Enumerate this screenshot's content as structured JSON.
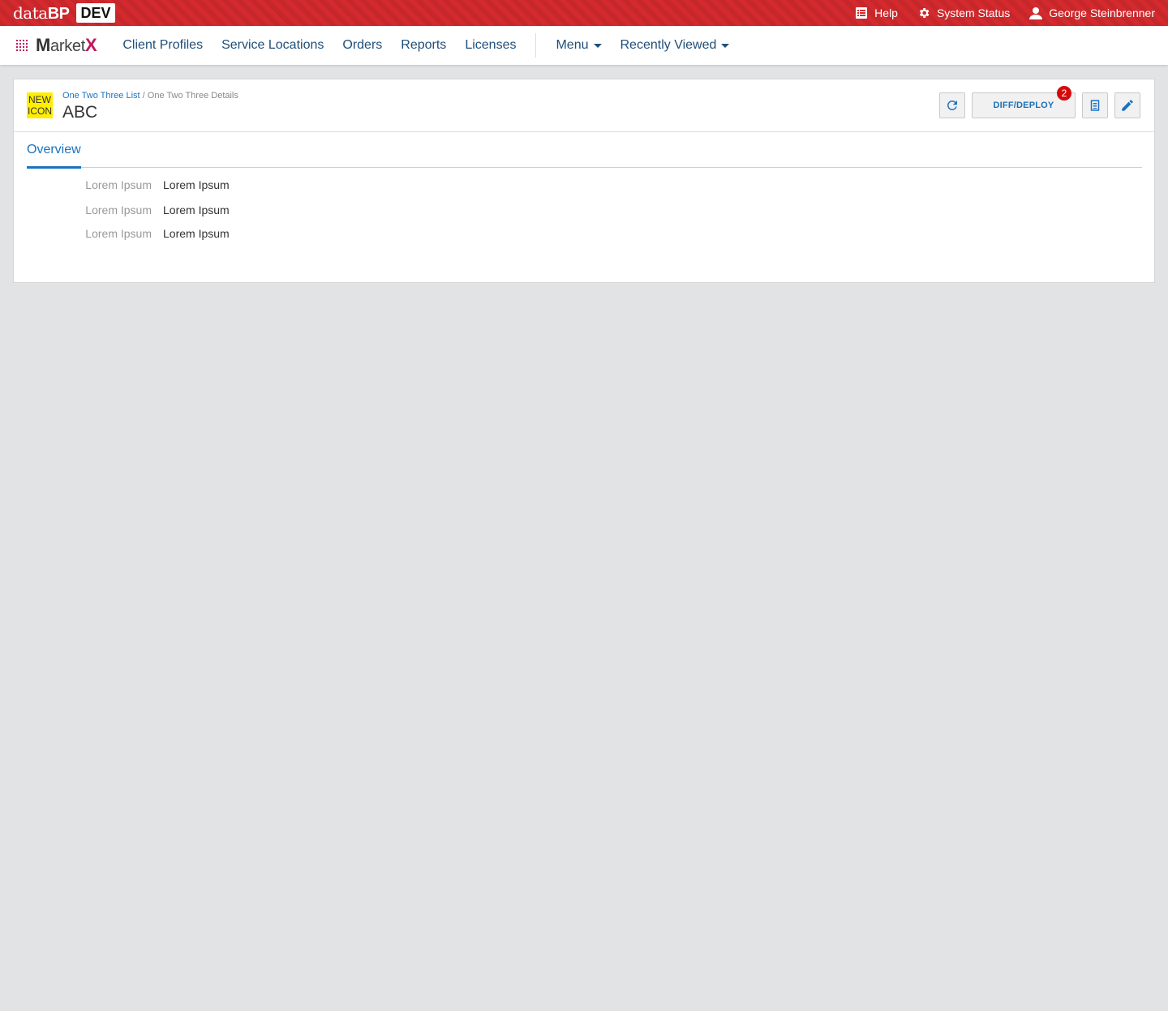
{
  "topbar": {
    "brand_light": "data",
    "brand_bold": "BP",
    "env": "DEV",
    "help": "Help",
    "system_status": "System Status",
    "user": "George Steinbrenner",
    "color": "#d42a2e"
  },
  "navbar": {
    "logo_m": "M",
    "logo_mid": "arket",
    "logo_x": "X",
    "items": [
      "Client Profiles",
      "Service Locations",
      "Orders",
      "Reports",
      "Licenses"
    ],
    "menu": "Menu",
    "recently_viewed": "Recently Viewed"
  },
  "header": {
    "new_icon_line1": "NEW",
    "new_icon_line2": "ICON",
    "breadcrumb_link": "One Two Three List",
    "breadcrumb_sep": "/",
    "breadcrumb_current": "One Two Three Details",
    "title": "ABC",
    "diff_deploy": "DIFF/DEPLOY",
    "diff_deploy_count": "2"
  },
  "tabs": {
    "overview": "Overview"
  },
  "fields": [
    {
      "label": "Lorem Ipsum",
      "value": "Lorem Ipsum"
    },
    {
      "label": "Lorem Ipsum",
      "value": "Lorem Ipsum"
    },
    {
      "label": "Lorem Ipsum",
      "value": "Lorem Ipsum"
    }
  ],
  "icons": {
    "help": "help-list-icon",
    "system_status": "gear-icon",
    "user": "user-icon",
    "refresh": "refresh-icon",
    "notes": "notes-icon",
    "edit": "pencil-icon"
  }
}
